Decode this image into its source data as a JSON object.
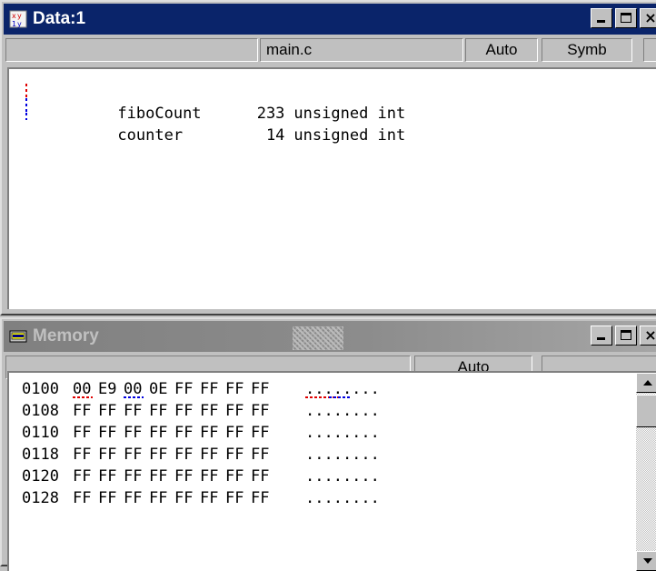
{
  "data_window": {
    "title": "Data:1",
    "toolbar": {
      "file": "main.c",
      "mode": "Auto",
      "format": "Symb"
    },
    "variables": [
      {
        "name": "fiboCount",
        "value": "233",
        "type": "unsigned int"
      },
      {
        "name": "counter",
        "value": "14",
        "type": "unsigned int"
      }
    ]
  },
  "memory_window": {
    "title": "Memory",
    "toolbar": {
      "mode": "Auto"
    },
    "rows": [
      {
        "address": "0100",
        "bytes": [
          "00",
          "E9",
          "00",
          "0E",
          "FF",
          "FF",
          "FF",
          "FF"
        ],
        "ascii": "........"
      },
      {
        "address": "0108",
        "bytes": [
          "FF",
          "FF",
          "FF",
          "FF",
          "FF",
          "FF",
          "FF",
          "FF"
        ],
        "ascii": "........"
      },
      {
        "address": "0110",
        "bytes": [
          "FF",
          "FF",
          "FF",
          "FF",
          "FF",
          "FF",
          "FF",
          "FF"
        ],
        "ascii": "........"
      },
      {
        "address": "0118",
        "bytes": [
          "FF",
          "FF",
          "FF",
          "FF",
          "FF",
          "FF",
          "FF",
          "FF"
        ],
        "ascii": "........"
      },
      {
        "address": "0120",
        "bytes": [
          "FF",
          "FF",
          "FF",
          "FF",
          "FF",
          "FF",
          "FF",
          "FF"
        ],
        "ascii": "........"
      },
      {
        "address": "0128",
        "bytes": [
          "FF",
          "FF",
          "FF",
          "FF",
          "FF",
          "FF",
          "FF",
          "FF"
        ],
        "ascii": "........"
      }
    ]
  },
  "caption_buttons": {
    "minimize": "",
    "maximize": "",
    "close": "×"
  },
  "colors": {
    "active_title": "#0a246a",
    "inactive_title": "#808080",
    "face": "#c0c0c0",
    "changed_marker": "#e00000",
    "accessed_marker": "#0000e0"
  }
}
